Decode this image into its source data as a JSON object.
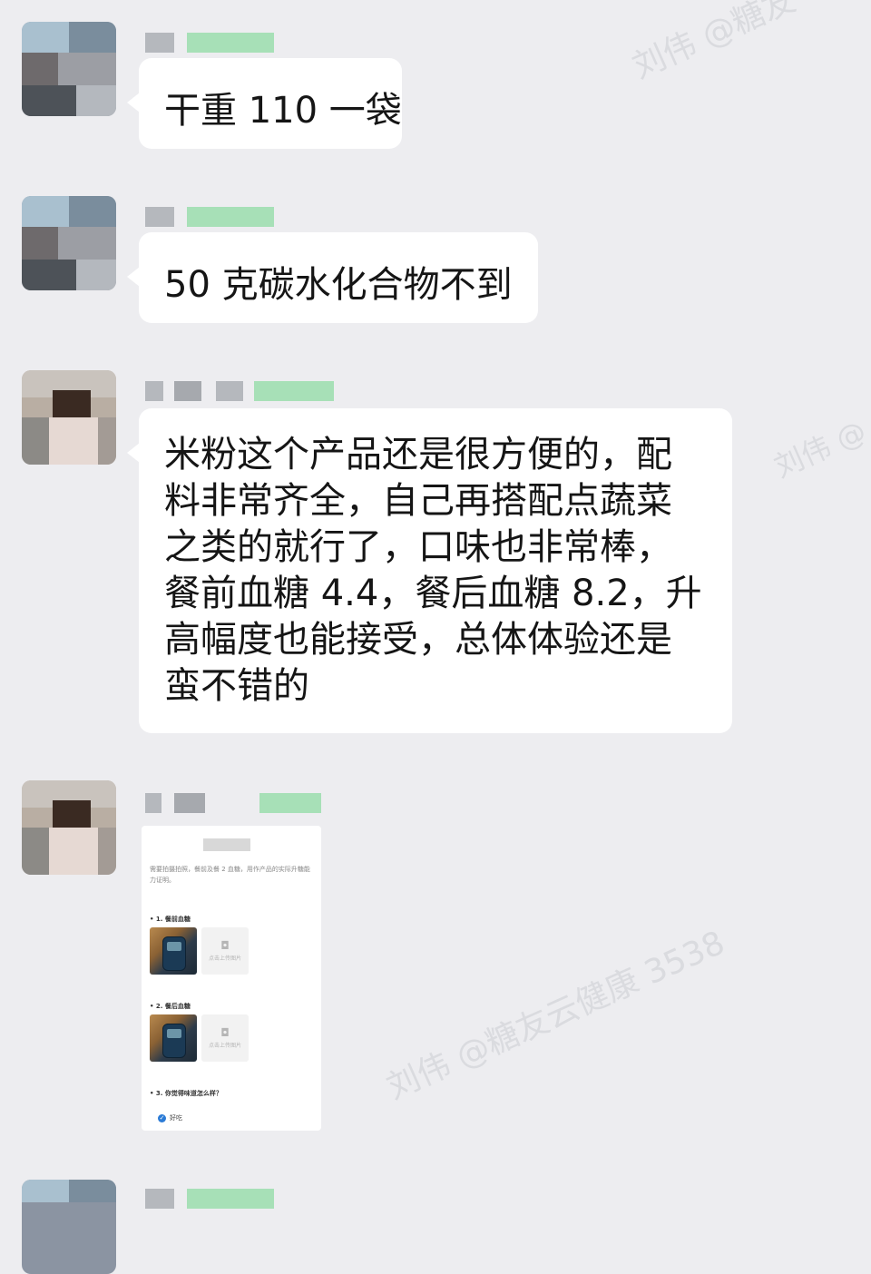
{
  "messages": [
    {
      "text": "干重 110 一袋"
    },
    {
      "text": "50 克碳水化合物不到"
    },
    {
      "text": "米粉这个产品还是很方便的，配\n料非常齐全，自己再搭配点蔬菜\n之类的就行了，口味也非常棒，\n餐前血糖 4.4，餐后血糖 8.2，升\n高幅度也能接受，总体体验还是\n蛮不错的"
    }
  ],
  "form_image": {
    "instructions": "需要拍摄拍照，餐前及餐 2 血糖，用作产品的实际升糖能力证明。",
    "q1": "• 1. 餐前血糖",
    "q2": "• 2. 餐后血糖",
    "q3": "• 3. 你觉得味道怎么样？",
    "upload_label": "点击上传图片",
    "answer": "好吃"
  },
  "watermark": {
    "text": "刘伟 @糖友云健康 3538",
    "text_top": "刘伟 @糖友",
    "text_right": "刘伟 @"
  },
  "colors": {
    "background": "#ededf0",
    "bubble": "#ffffff",
    "text": "#151515",
    "check": "#2b7bd6"
  }
}
